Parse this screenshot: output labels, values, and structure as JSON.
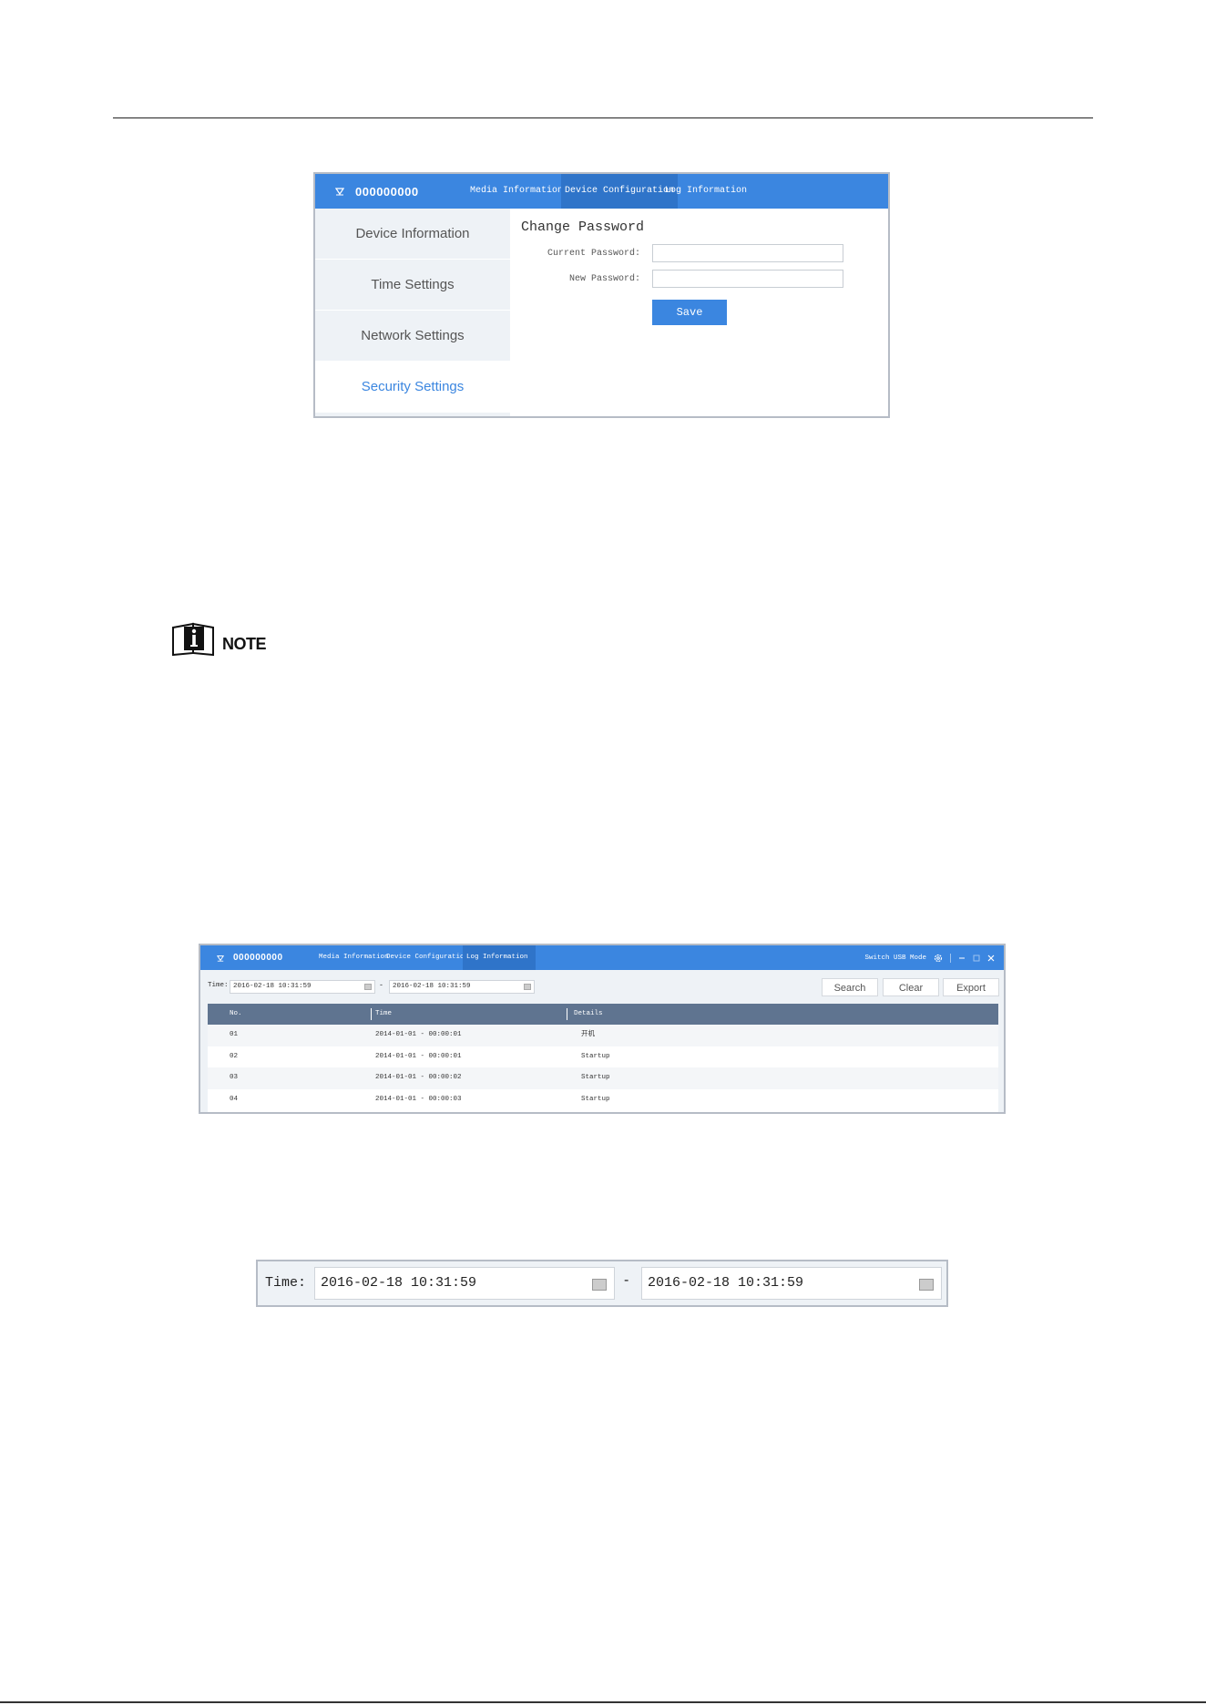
{
  "screenshot1": {
    "device_name": "000000000",
    "tabs": [
      {
        "label": "Media Information"
      },
      {
        "label": "Device Configuration"
      },
      {
        "label": "Log Information"
      }
    ],
    "sidebar": [
      {
        "label": "Device Information"
      },
      {
        "label": "Time Settings"
      },
      {
        "label": "Network Settings"
      },
      {
        "label": "Security Settings"
      }
    ],
    "content": {
      "title": "Change Password",
      "current_password_label": "Current Password:",
      "new_password_label": "New Password:",
      "save_label": "Save"
    }
  },
  "note": {
    "label": "NOTE"
  },
  "screenshot2": {
    "device_name": "000000000",
    "tabs": [
      {
        "label": "Media Information"
      },
      {
        "label": "Device Configuration"
      },
      {
        "label": "Log Information"
      }
    ],
    "switch_label": "Switch USB Mode",
    "time_label": "Time:",
    "start_time": "2016-02-18 10:31:59",
    "dash": "-",
    "end_time": "2016-02-18 10:31:59",
    "buttons": {
      "search": "Search",
      "clear": "Clear",
      "export": "Export"
    },
    "columns": {
      "no": "No.",
      "time": "Time",
      "details": "Details"
    },
    "rows": [
      {
        "no": "01",
        "time": "2014-01-01 - 00:00:01",
        "details": "开机"
      },
      {
        "no": "02",
        "time": "2014-01-01 - 00:00:01",
        "details": "Startup"
      },
      {
        "no": "03",
        "time": "2014-01-01 - 00:00:02",
        "details": "Startup"
      },
      {
        "no": "04",
        "time": "2014-01-01 - 00:00:03",
        "details": "Startup"
      }
    ]
  },
  "screenshot3": {
    "time_label": "Time:",
    "start_time": "2016-02-18 10:31:59",
    "dash": "-",
    "end_time": "2016-02-18 10:31:59"
  },
  "colors": {
    "accent": "#3b86e0",
    "table_header": "#5f7490",
    "panel_bg": "#eef2f6"
  }
}
